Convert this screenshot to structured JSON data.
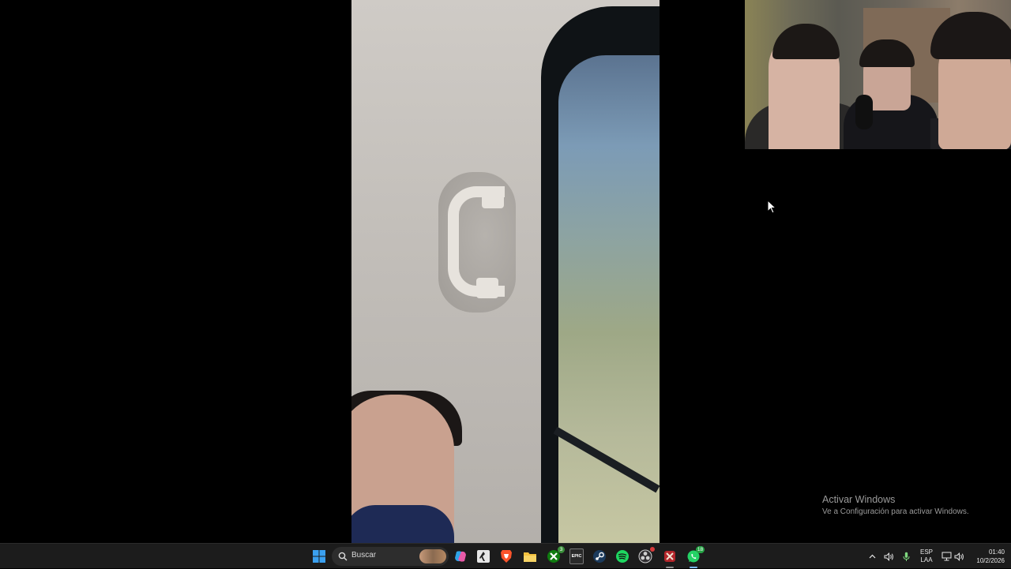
{
  "desktop": {
    "activation": {
      "title": "Activar Windows",
      "subtitle": "Ve a Configuración para activar Windows."
    }
  },
  "taskbar": {
    "search_label": "Buscar",
    "apps": [
      {
        "name": "start-icon"
      },
      {
        "name": "copilot-icon"
      },
      {
        "name": "run-app-icon"
      },
      {
        "name": "brave-browser-icon"
      },
      {
        "name": "file-explorer-icon"
      },
      {
        "name": "xbox-icon",
        "badge": "3"
      },
      {
        "name": "epic-games-icon",
        "label": "EPIC"
      },
      {
        "name": "steam-icon"
      },
      {
        "name": "spotify-icon"
      },
      {
        "name": "obs-icon"
      },
      {
        "name": "game-icon"
      },
      {
        "name": "whatsapp-icon",
        "badge": "18"
      }
    ],
    "tray": {
      "language_top": "ESP",
      "language_bottom": "LAA",
      "time": "01:40",
      "date": "10/2/2026"
    }
  },
  "colors": {
    "taskbar_bg": "#1c1c1c",
    "accent": "#0078d4",
    "badge_green": "#25a244"
  }
}
